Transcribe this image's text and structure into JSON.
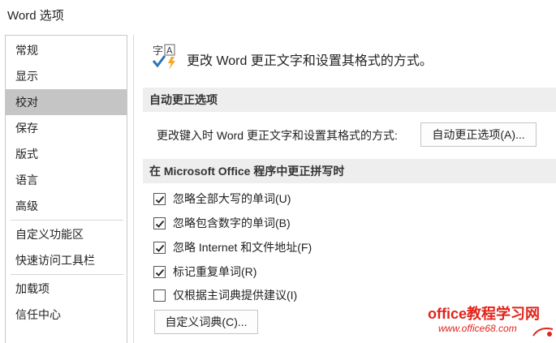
{
  "window": {
    "title": "Word 选项"
  },
  "sidebar": {
    "items": [
      {
        "label": "常规",
        "selected": false
      },
      {
        "label": "显示",
        "selected": false
      },
      {
        "label": "校对",
        "selected": true
      },
      {
        "label": "保存",
        "selected": false
      },
      {
        "label": "版式",
        "selected": false
      },
      {
        "label": "语言",
        "selected": false
      },
      {
        "label": "高级",
        "selected": false
      },
      {
        "label": "自定义功能区",
        "selected": false
      },
      {
        "label": "快速访问工具栏",
        "selected": false
      },
      {
        "label": "加载项",
        "selected": false
      },
      {
        "label": "信任中心",
        "selected": false
      }
    ]
  },
  "header": {
    "text": "更改 Word 更正文字和设置其格式的方式。",
    "icon": "proofing-abc-check-icon"
  },
  "autocorrect_section": {
    "title": "自动更正选项",
    "row_label": "更改键入时 Word 更正文字和设置其格式的方式:",
    "button_label": "自动更正选项(A)..."
  },
  "office_section": {
    "title": "在 Microsoft Office 程序中更正拼写时",
    "options": [
      {
        "label": "忽略全部大写的单词(U)",
        "checked": true
      },
      {
        "label": "忽略包含数字的单词(B)",
        "checked": true
      },
      {
        "label": "忽略 Internet 和文件地址(F)",
        "checked": true
      },
      {
        "label": "标记重复单词(R)",
        "checked": true
      },
      {
        "label": "仅根据主词典提供建议(I)",
        "checked": false
      }
    ],
    "dict_button_label": "自定义词典(C)..."
  },
  "watermark": {
    "line1": "office教程学习网",
    "line2": "www.office68.com"
  },
  "colors": {
    "selected_bg": "#c5c5c5",
    "section_bg": "#eeeeee",
    "watermark": "#e2231a",
    "icon_blue": "#2e75b6",
    "icon_orange": "#f5a623"
  }
}
